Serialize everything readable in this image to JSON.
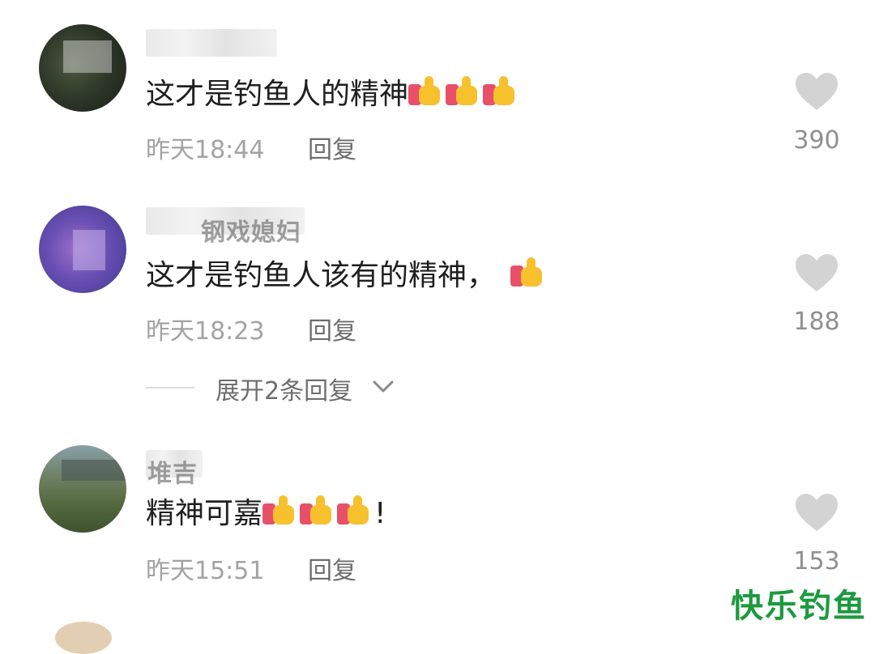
{
  "comments": [
    {
      "text": "这才是钓鱼人的精神",
      "emoji_count": 3,
      "trailing": "",
      "time": "昨天18:44",
      "reply_label": "回复",
      "likes": "390"
    },
    {
      "name_fragment": "钢戏媳妇",
      "text": "这才是钓鱼人该有的精神，",
      "emoji_count": 1,
      "trailing": "",
      "time": "昨天18:23",
      "reply_label": "回复",
      "likes": "188"
    },
    {
      "name_fragment": "堆吉",
      "text": "精神可嘉",
      "emoji_count": 3,
      "trailing": "!",
      "time": "昨天15:51",
      "reply_label": "回复",
      "likes": "153"
    }
  ],
  "expand_replies": {
    "label": "展开2条回复"
  },
  "watermark": "快乐钓鱼",
  "icons": {
    "like": "heart-icon",
    "expand": "chevron-down-icon",
    "emoji": "thumbs-up-icon"
  },
  "colors": {
    "heart": "#d3d3d3",
    "text": "#1f1f1f",
    "meta": "#a3a3a3",
    "watermark": "#1c9a3e"
  }
}
